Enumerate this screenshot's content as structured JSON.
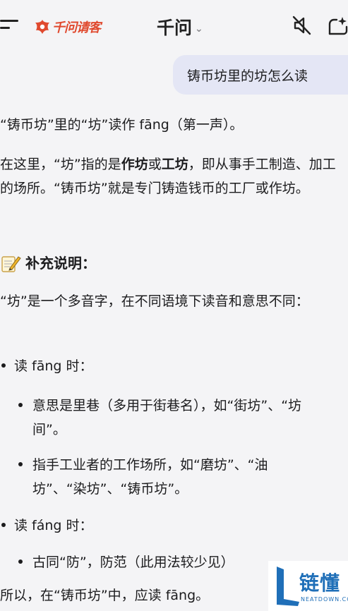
{
  "header": {
    "brand": "千问请客",
    "title": "千问",
    "title_chevron": "⌄"
  },
  "query": "铸币坊里的坊怎么读",
  "answer": {
    "p1": "“铸币坊”里的“坊”读作 fāng（第一声）。",
    "p2_a": "在这里，“坊”指的是",
    "p2_b": "作坊",
    "p2_c": "或",
    "p2_d": "工坊",
    "p2_e": "，即从事手工制造、加工的场所。“铸币坊”就是专门铸造钱币的工厂或作坊。",
    "h3": "补充说明：",
    "p3": "“坊”是一个多音字，在不同语境下读音和意思不同：",
    "b1": "读 fāng 时：",
    "b1_1": "意思是里巷（多用于街巷名），如“街坊”、“坊间”。",
    "b1_2": "指手工业者的工作场所，如“磨坊”、“油坊”、“染坊”、“铸币坊”。",
    "b2": "读 fáng 时：",
    "b2_1": "古同“防”，防范（此用法较少见）",
    "conclusion": "所以，在“铸币坊”中，应读 fāng。"
  },
  "watermark": {
    "text": "链懂",
    "sub": "NEATDOWN.COM"
  },
  "colors": {
    "brand": "#e0492e",
    "bubble": "#e4e6f5",
    "background": "#f4f4f6",
    "watermark": "#1f6fb8"
  }
}
